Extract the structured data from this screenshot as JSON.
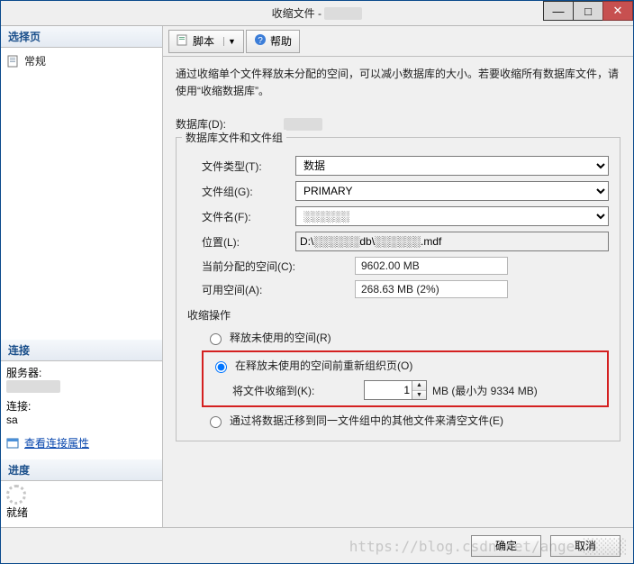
{
  "window": {
    "title_prefix": "收缩文件 - ",
    "min": "—",
    "max": "□",
    "close": "✕"
  },
  "left": {
    "select_page_header": "选择页",
    "general_item": "常规",
    "connection_header": "连接",
    "server_label": "服务器:",
    "server_value": "░░░░░░░",
    "conn_label": "连接:",
    "conn_value": "sa",
    "view_props_link": "查看连接属性",
    "progress_header": "进度",
    "ready_label": "就绪"
  },
  "toolbar": {
    "script_label": "脚本",
    "help_label": "帮助"
  },
  "form": {
    "intro": "通过收缩单个文件释放未分配的空间，可以减小数据库的大小。若要收缩所有数据库文件，请使用“收缩数据库”。",
    "database_label": "数据库(D):",
    "database_value": "░░░░░",
    "group_legend": "数据库文件和文件组",
    "file_type_label": "文件类型(T):",
    "file_type_value": "数据",
    "filegroup_label": "文件组(G):",
    "filegroup_value": "PRIMARY",
    "filename_label": "文件名(F):",
    "filename_value": "░░░░░░",
    "location_label": "位置(L):",
    "location_value": "D:\\░░░░░░db\\░░░░░░.mdf",
    "alloc_label": "当前分配的空间(C):",
    "alloc_value": "9602.00 MB",
    "avail_label": "可用空间(A):",
    "avail_value": "268.63 MB (2%)",
    "shrink_action_label": "收缩操作",
    "radio_release": "释放未使用的空间(R)",
    "radio_reorg": "在释放未使用的空间前重新组织页(O)",
    "shrink_to_label": "将文件收缩到(K):",
    "shrink_to_value": "1",
    "mb_min": "MB (最小为 9334 MB)",
    "radio_migrate": "通过将数据迁移到同一文件组中的其他文件来清空文件(E)"
  },
  "footer": {
    "ok": "确定",
    "cancel": "取消"
  },
  "watermark": "https://blog.csdn.net/angel░░░░░"
}
